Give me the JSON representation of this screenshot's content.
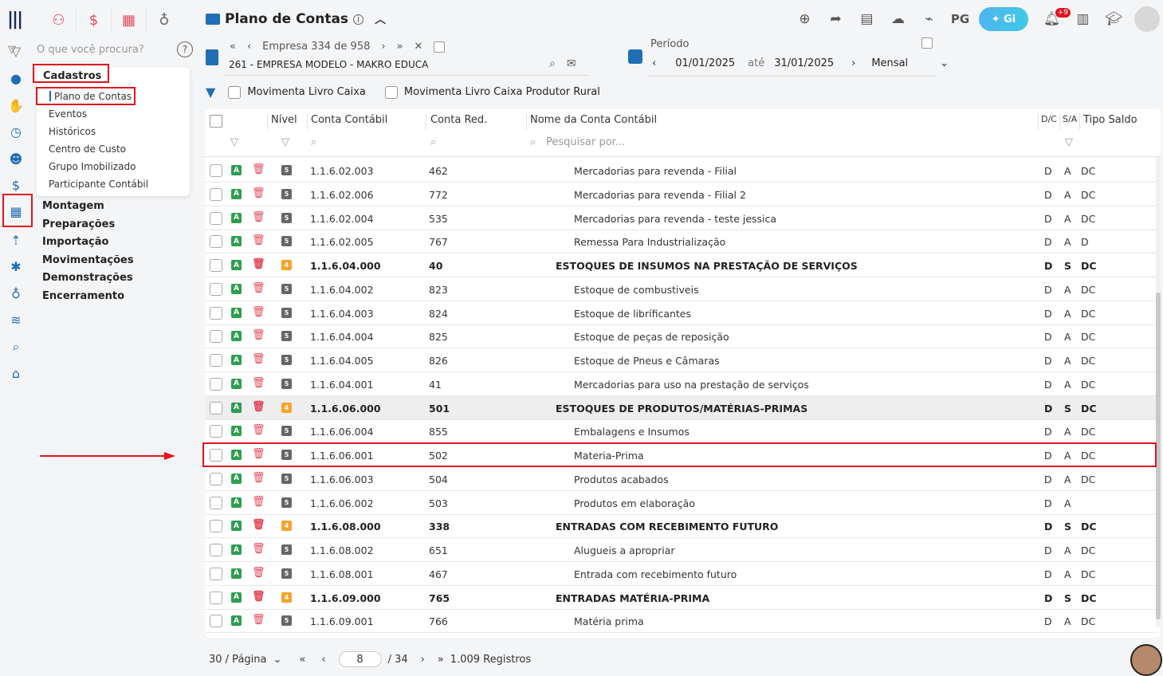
{
  "app": {
    "title": "Plano de Contas",
    "search_placeholder": "O que você procura?",
    "top_icons": [
      "people-icon",
      "dollar-icon",
      "calculator-icon",
      "money-bag-icon"
    ],
    "header_icons": [
      "plus-circle-icon",
      "share-icon",
      "document-icon",
      "cloud-upload-icon",
      "satellite-icon"
    ],
    "pg_label": "PG",
    "gi_label": "Gi",
    "notif_badge": "+9"
  },
  "menu": {
    "section": "Cadastros",
    "items": [
      "Plano de Contas",
      "Eventos",
      "Históricos",
      "Centro de Custo",
      "Grupo Imobilizado",
      "Participante Contábil"
    ],
    "groups": [
      "Montagem",
      "Preparações",
      "Importação",
      "Movimentações",
      "Demonstrações",
      "Encerramento"
    ]
  },
  "empresa": {
    "nav_label": "Empresa 334 de 958",
    "name": "261 - EMPRESA MODELO - MAKRO EDUCA"
  },
  "periodo": {
    "label": "Período",
    "start": "01/01/2025",
    "ate": "até",
    "end": "31/01/2025",
    "mode": "Mensal"
  },
  "filters": {
    "f1": "Movimenta Livro Caixa",
    "f2": "Movimenta Livro Caixa Produtor Rural"
  },
  "table": {
    "headers": {
      "nivel": "Nível",
      "conta": "Conta Contábil",
      "red": "Conta Red.",
      "nome": "Nome da Conta Contábil",
      "dc": "D/C",
      "sa": "S/A",
      "tipo": "Tipo Saldo"
    },
    "search_placeholder": "Pesquisar por...",
    "rows": [
      {
        "lvl": "5",
        "conta": "1.1.6.02.003",
        "red": "462",
        "nome": "Mercadorias para revenda - Filial",
        "dc": "D",
        "sa": "A",
        "tipo": "DC",
        "bold": false
      },
      {
        "lvl": "5",
        "conta": "1.1.6.02.006",
        "red": "772",
        "nome": "Mercadorias para revenda - Filial 2",
        "dc": "D",
        "sa": "A",
        "tipo": "DC",
        "bold": false
      },
      {
        "lvl": "5",
        "conta": "1.1.6.02.004",
        "red": "535",
        "nome": "Mercadorias para revenda - teste jessica",
        "dc": "D",
        "sa": "A",
        "tipo": "DC",
        "bold": false
      },
      {
        "lvl": "5",
        "conta": "1.1.6.02.005",
        "red": "767",
        "nome": "Remessa Para Industrialização",
        "dc": "D",
        "sa": "A",
        "tipo": "D",
        "bold": false
      },
      {
        "lvl": "4",
        "conta": "1.1.6.04.000",
        "red": "40",
        "nome": "ESTOQUES DE INSUMOS NA PRESTAÇÃO DE SERVIÇOS",
        "dc": "D",
        "sa": "S",
        "tipo": "DC",
        "bold": true
      },
      {
        "lvl": "5",
        "conta": "1.1.6.04.002",
        "red": "823",
        "nome": "Estoque de combustiveis",
        "dc": "D",
        "sa": "A",
        "tipo": "DC",
        "bold": false
      },
      {
        "lvl": "5",
        "conta": "1.1.6.04.003",
        "red": "824",
        "nome": "Estoque de libríficantes",
        "dc": "D",
        "sa": "A",
        "tipo": "DC",
        "bold": false
      },
      {
        "lvl": "5",
        "conta": "1.1.6.04.004",
        "red": "825",
        "nome": "Estoque de peças de reposição",
        "dc": "D",
        "sa": "A",
        "tipo": "DC",
        "bold": false
      },
      {
        "lvl": "5",
        "conta": "1.1.6.04.005",
        "red": "826",
        "nome": "Estoque de Pneus e Câmaras",
        "dc": "D",
        "sa": "A",
        "tipo": "DC",
        "bold": false
      },
      {
        "lvl": "5",
        "conta": "1.1.6.04.001",
        "red": "41",
        "nome": "Mercadorias para uso na prestação de serviços",
        "dc": "D",
        "sa": "A",
        "tipo": "DC",
        "bold": false
      },
      {
        "lvl": "4",
        "conta": "1.1.6.06.000",
        "red": "501",
        "nome": "ESTOQUES DE PRODUTOS/MATÉRIAS-PRIMAS",
        "dc": "D",
        "sa": "S",
        "tipo": "DC",
        "bold": true
      },
      {
        "lvl": "5",
        "conta": "1.1.6.06.004",
        "red": "855",
        "nome": "Embalagens e Insumos",
        "dc": "D",
        "sa": "A",
        "tipo": "DC",
        "bold": false
      },
      {
        "lvl": "5",
        "conta": "1.1.6.06.001",
        "red": "502",
        "nome": "Materia-Prima",
        "dc": "D",
        "sa": "A",
        "tipo": "DC",
        "bold": false
      },
      {
        "lvl": "5",
        "conta": "1.1.6.06.003",
        "red": "504",
        "nome": "Produtos acabados",
        "dc": "D",
        "sa": "A",
        "tipo": "DC",
        "bold": false
      },
      {
        "lvl": "5",
        "conta": "1.1.6.06.002",
        "red": "503",
        "nome": "Produtos em elaboração",
        "dc": "D",
        "sa": "A",
        "tipo": "",
        "bold": false
      },
      {
        "lvl": "4",
        "conta": "1.1.6.08.000",
        "red": "338",
        "nome": "ENTRADAS COM RECEBIMENTO FUTURO",
        "dc": "D",
        "sa": "S",
        "tipo": "DC",
        "bold": true
      },
      {
        "lvl": "5",
        "conta": "1.1.6.08.002",
        "red": "651",
        "nome": "Alugueis a apropriar",
        "dc": "D",
        "sa": "A",
        "tipo": "DC",
        "bold": false
      },
      {
        "lvl": "5",
        "conta": "1.1.6.08.001",
        "red": "467",
        "nome": "Entrada com recebimento futuro",
        "dc": "D",
        "sa": "A",
        "tipo": "DC",
        "bold": false
      },
      {
        "lvl": "4",
        "conta": "1.1.6.09.000",
        "red": "765",
        "nome": "ENTRADAS MATÉRIA-PRIMA",
        "dc": "D",
        "sa": "S",
        "tipo": "DC",
        "bold": true
      },
      {
        "lvl": "5",
        "conta": "1.1.6.09.001",
        "red": "766",
        "nome": "Matéria prima",
        "dc": "D",
        "sa": "A",
        "tipo": "DC",
        "bold": false
      }
    ]
  },
  "footer": {
    "per_page": "30 / Página",
    "page": "8",
    "total_pages": "/ 34",
    "records": "1.009 Registros"
  },
  "colors": {
    "accent": "#1f6fb5",
    "highlight_box": "#e0141e",
    "active_badge": "#2e9e4f",
    "level4": "#f3a52c",
    "level5": "#666666"
  }
}
